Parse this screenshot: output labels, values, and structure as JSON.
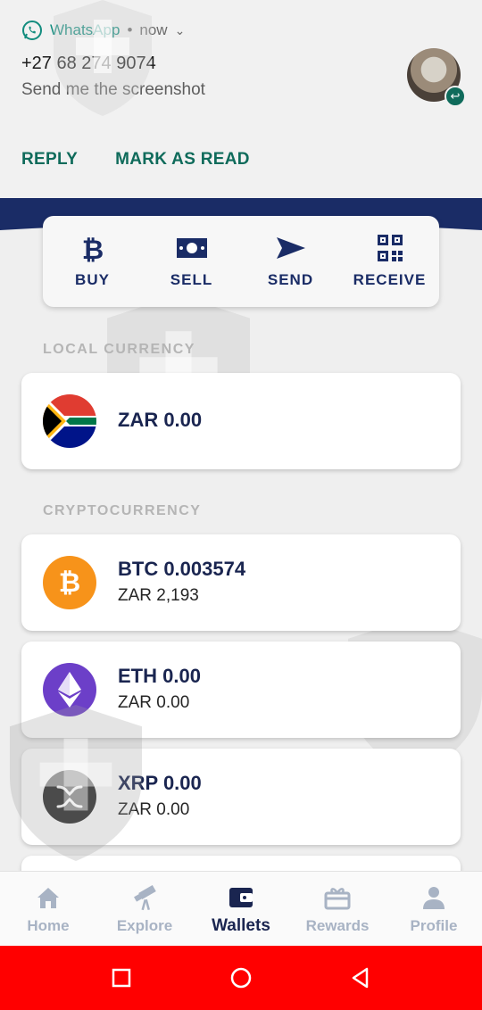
{
  "notification": {
    "app_name": "WhatsApp",
    "separator": "•",
    "time": "now",
    "title": "+27 68 274 9074",
    "text": "Send me the screenshot",
    "actions": [
      "REPLY",
      "MARK AS READ"
    ]
  },
  "quick_actions": [
    {
      "label": "BUY",
      "icon": "bitcoin-icon"
    },
    {
      "label": "SELL",
      "icon": "banknote-icon"
    },
    {
      "label": "SEND",
      "icon": "send-icon"
    },
    {
      "label": "RECEIVE",
      "icon": "qr-code-icon"
    }
  ],
  "sections": {
    "local": "LOCAL CURRENCY",
    "crypto": "CRYPTOCURRENCY"
  },
  "wallets": {
    "zar": {
      "main": "ZAR 0.00",
      "icon": "south-africa-flag-icon"
    },
    "btc": {
      "main": "BTC 0.003574",
      "sub": "ZAR 2,193",
      "icon": "bitcoin-icon",
      "color": "#f7931a"
    },
    "eth": {
      "main": "ETH 0.00",
      "sub": "ZAR 0.00",
      "icon": "ethereum-icon",
      "color": "#6c3fc8"
    },
    "xrp": {
      "main": "XRP 0.00",
      "sub": "ZAR 0.00",
      "icon": "xrp-icon",
      "color": "#2b2b2b"
    }
  },
  "bottom_nav": [
    {
      "label": "Home",
      "icon": "home-icon",
      "active": false
    },
    {
      "label": "Explore",
      "icon": "telescope-icon",
      "active": false
    },
    {
      "label": "Wallets",
      "icon": "wallet-icon",
      "active": true
    },
    {
      "label": "Rewards",
      "icon": "gift-icon",
      "active": false
    },
    {
      "label": "Profile",
      "icon": "person-icon",
      "active": false
    }
  ],
  "colors": {
    "navy": "#1a2c66",
    "whatsapp_green": "#0f6b5b",
    "android_nav": "#ff0000"
  }
}
